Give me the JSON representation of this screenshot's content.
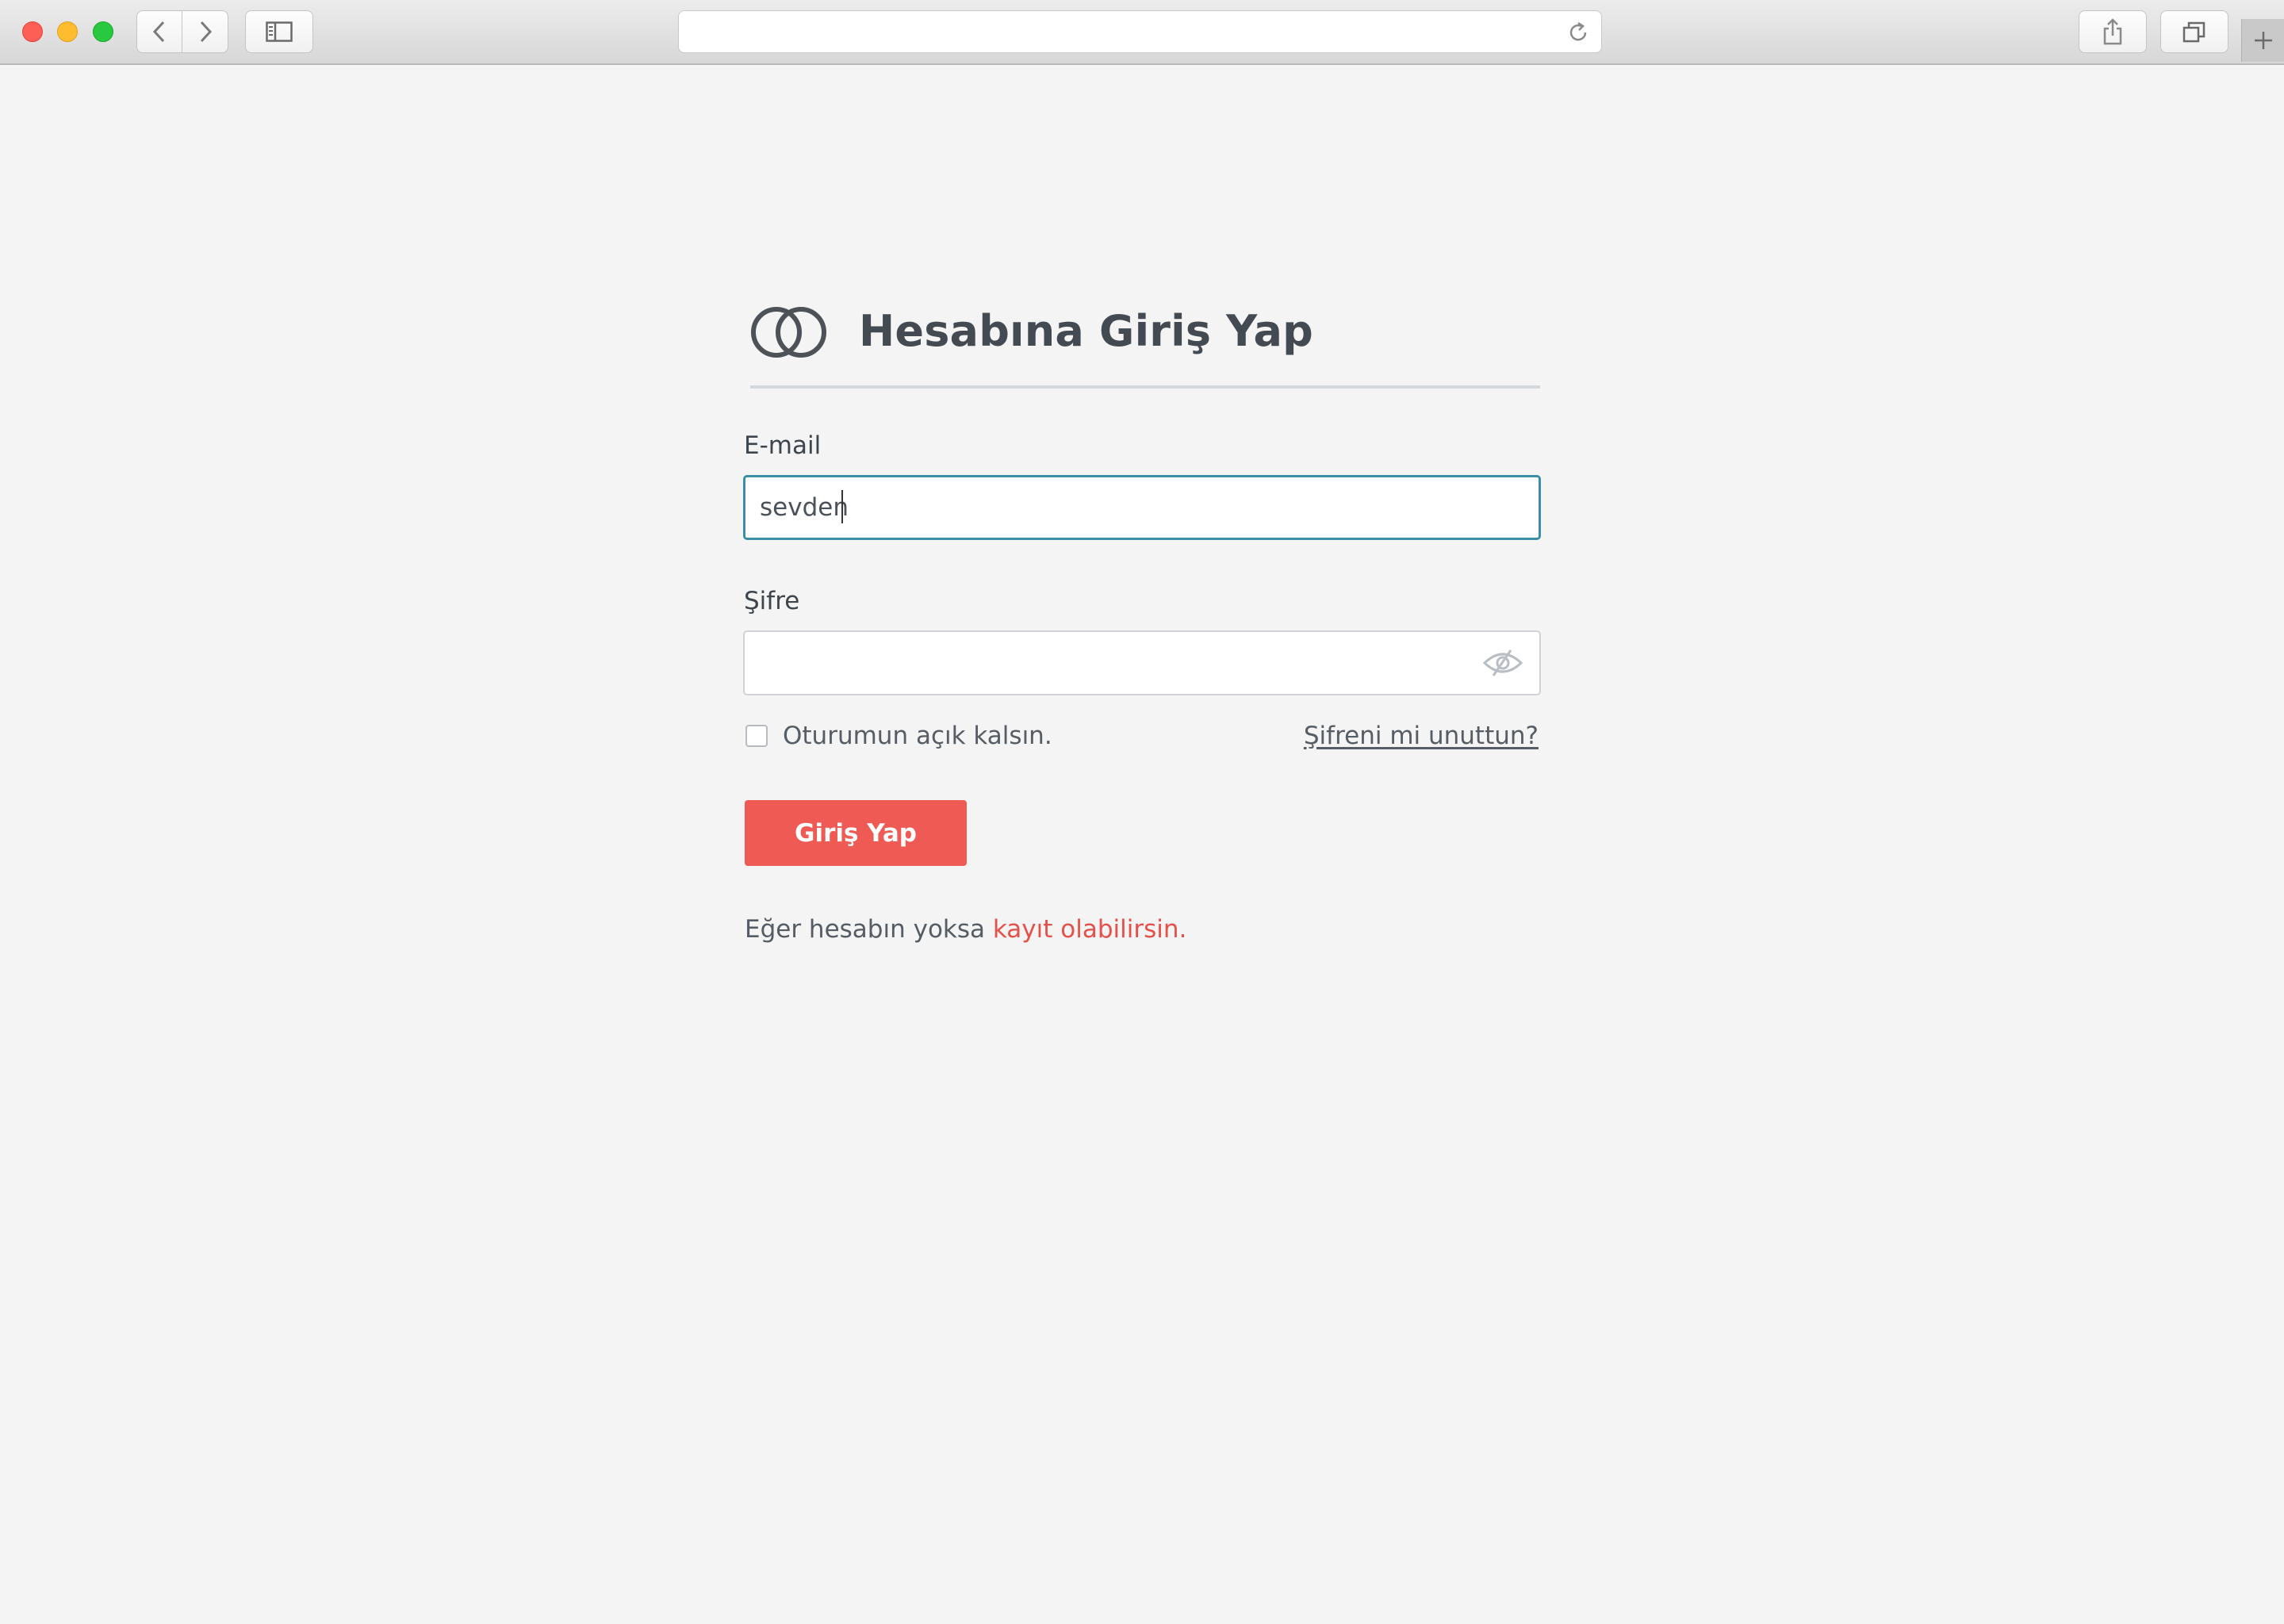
{
  "browser": {
    "address_value": ""
  },
  "login": {
    "title": "Hesabına Giriş Yap",
    "email_label": "E-mail",
    "email_value": "sevden",
    "password_label": "Şifre",
    "password_value": "",
    "remember_label": "Oturumun açık kalsın.",
    "forgot_link": "Şifreni mi unuttun?",
    "submit_label": "Giriş Yap",
    "signup_text": "Eğer hesabın yoksa",
    "signup_link": "kayıt olabilirsin."
  },
  "colors": {
    "accent": "#ef5b54",
    "focus_border": "#3b8ea5",
    "title_text": "#444a52"
  },
  "icons": {
    "logo": "interlocking-rings-icon",
    "password_toggle": "eye-slash-icon"
  }
}
